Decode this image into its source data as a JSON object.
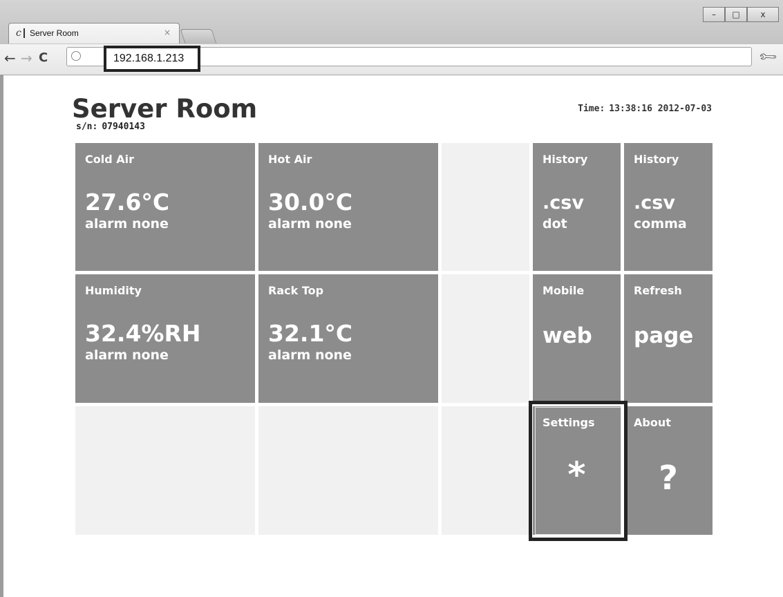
{
  "browser": {
    "tab_title": "Server Room",
    "tab_close": "×",
    "url": "192.168.1.213",
    "window_controls": {
      "minimize": "–",
      "maximize": "□",
      "close": "x"
    },
    "nav": {
      "back": "←",
      "forward": "→",
      "reload": "C"
    }
  },
  "page": {
    "title": "Server Room",
    "serial_label": "s/n:",
    "serial": "07940143",
    "time_label": "Time:",
    "time_value": "13:38:16 2012-07-03"
  },
  "sensors": [
    {
      "label": "Cold Air",
      "value": "27.6°C",
      "alarm": "alarm none"
    },
    {
      "label": "Hot Air",
      "value": "30.0°C",
      "alarm": "alarm none"
    },
    {
      "label": "Humidity",
      "value": "32.4%RH",
      "alarm": "alarm none"
    },
    {
      "label": "Rack Top",
      "value": "32.1°C",
      "alarm": "alarm none"
    }
  ],
  "actions": {
    "history_dot": {
      "label": "History",
      "big": ".csv",
      "sub": "dot"
    },
    "history_comma": {
      "label": "History",
      "big": ".csv",
      "sub": "comma"
    },
    "mobile": {
      "label": "Mobile",
      "big": "web"
    },
    "refresh": {
      "label": "Refresh",
      "big": "page"
    },
    "settings": {
      "label": "Settings",
      "glyph": "*"
    },
    "about": {
      "label": "About",
      "glyph": "?"
    }
  },
  "colors": {
    "tile_dark": "#8c8c8c",
    "tile_light": "#f1f1f1",
    "text_dark": "#333333",
    "highlight_border": "#222222"
  }
}
